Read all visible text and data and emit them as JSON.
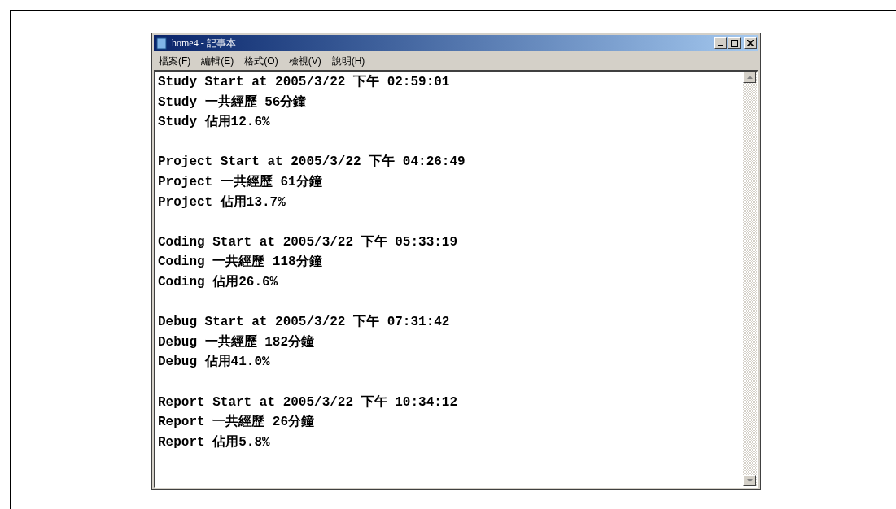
{
  "window": {
    "title": "home4 - 記事本"
  },
  "menu": [
    "檔案(F)",
    "編輯(E)",
    "格式(O)",
    "檢視(V)",
    "說明(H)"
  ],
  "text_blocks": [
    {
      "lines": [
        "Study Start at 2005/3/22 下午 02:59:01",
        "Study 一共經歷 56分鐘",
        "Study 佔用12.6%"
      ]
    },
    {
      "lines": [
        "Project Start at 2005/3/22 下午 04:26:49",
        "Project 一共經歷 61分鐘",
        "Project 佔用13.7%"
      ]
    },
    {
      "lines": [
        "Coding Start at 2005/3/22 下午 05:33:19",
        "Coding 一共經歷 118分鐘",
        "Coding 佔用26.6%"
      ]
    },
    {
      "lines": [
        "Debug Start at 2005/3/22 下午 07:31:42",
        "Debug 一共經歷 182分鐘",
        "Debug 佔用41.0%"
      ]
    },
    {
      "lines": [
        "Report Start at 2005/3/22 下午 10:34:12",
        "Report 一共經歷 26分鐘",
        "Report 佔用5.8%"
      ]
    }
  ]
}
